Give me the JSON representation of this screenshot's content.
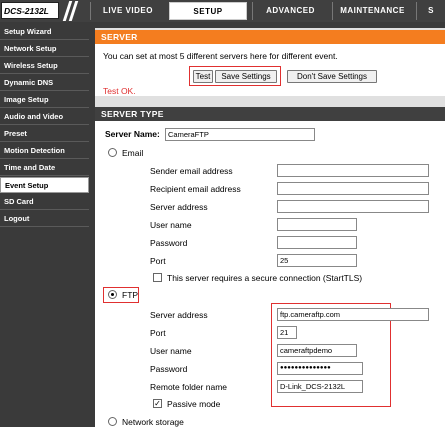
{
  "header": {
    "model": "DCS-2132L",
    "tabs": [
      "LIVE VIDEO",
      "SETUP",
      "ADVANCED",
      "MAINTENANCE",
      "S"
    ]
  },
  "sidebar": {
    "items": [
      "Setup Wizard",
      "Network Setup",
      "Wireless Setup",
      "Dynamic DNS",
      "Image Setup",
      "Audio and Video",
      "Preset",
      "Motion Detection",
      "Time and Date",
      "Event Setup",
      "SD Card",
      "Logout"
    ]
  },
  "server_panel": {
    "title": "SERVER",
    "description": "You can set at most 5 different servers here for different event.",
    "test_button": "Test",
    "save_button": "Save Settings",
    "dont_save_button": "Don't Save Settings",
    "status": "Test OK."
  },
  "server_type": {
    "title": "SERVER TYPE",
    "name_label": "Server Name:",
    "name_value": "CameraFTP",
    "email": {
      "label": "Email",
      "sender_label": "Sender email address",
      "recipient_label": "Recipient email address",
      "server_label": "Server address",
      "user_label": "User name",
      "password_label": "Password",
      "port_label": "Port",
      "port_value": "25",
      "tls_label": "This server requires a secure connection (StartTLS)"
    },
    "ftp": {
      "label": "FTP",
      "server_label": "Server address",
      "server_value": "ftp.cameraftp.com",
      "port_label": "Port",
      "port_value": "21",
      "user_label": "User name",
      "user_value": "cameraftpdemo",
      "password_label": "Password",
      "password_value": "●●●●●●●●●●●●●●",
      "folder_label": "Remote folder name",
      "folder_value": "D-Link_DCS-2132L",
      "passive_label": "Passive mode"
    },
    "network_storage_label": "Network storage"
  },
  "colors": {
    "accent_orange": "#f47d1f",
    "status_red": "#e03030",
    "dark_bar": "#404040"
  }
}
